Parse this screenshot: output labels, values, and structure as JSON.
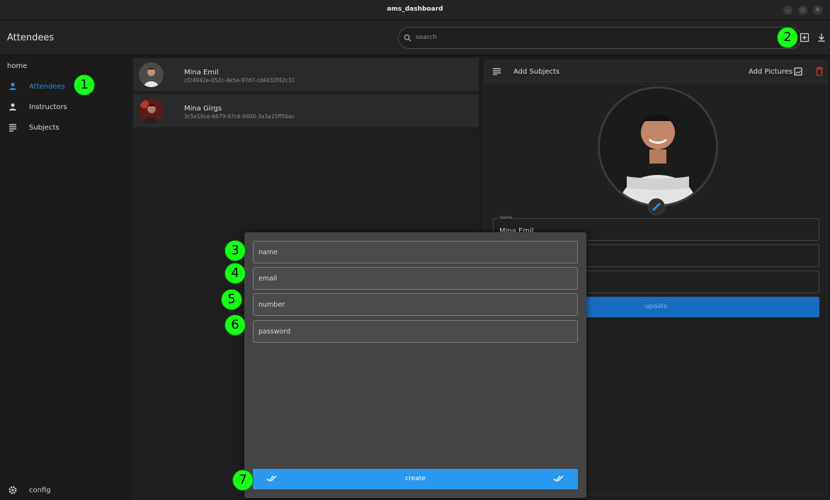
{
  "window": {
    "title": "ams_dashboard"
  },
  "appbar": {
    "title": "Attendees",
    "search_placeholder": "search"
  },
  "sidebar": {
    "home_label": "home",
    "items": [
      {
        "label": "Attendees",
        "icon": "person-icon",
        "active": true
      },
      {
        "label": "Instructors",
        "icon": "person-icon",
        "active": false
      },
      {
        "label": "Subjects",
        "icon": "list-icon",
        "active": false
      }
    ],
    "config_label": "config"
  },
  "attendees": [
    {
      "name": "Mina Emil",
      "id": "cf24042e-052c-4e5e-97d7-cd4432f42c31"
    },
    {
      "name": "Mina Girgs",
      "id": "3c5e10ce-6679-47c6-9400-3a3a15ff56ac"
    }
  ],
  "detail": {
    "add_subjects_label": "Add Subjects",
    "add_pictures_label": "Add Pictures",
    "name_field": {
      "label": "name",
      "value": "Mina Emil"
    },
    "update_label": "update"
  },
  "dialog": {
    "name_placeholder": "name",
    "email_placeholder": "email",
    "number_placeholder": "number",
    "password_placeholder": "password",
    "create_label": "create"
  },
  "markers": [
    "1",
    "2",
    "3",
    "4",
    "5",
    "6",
    "7"
  ],
  "colors": {
    "accent": "#2a98ee",
    "active_nav": "#2f8fe0",
    "delete": "#d9342b",
    "marker": "#17ff17"
  }
}
